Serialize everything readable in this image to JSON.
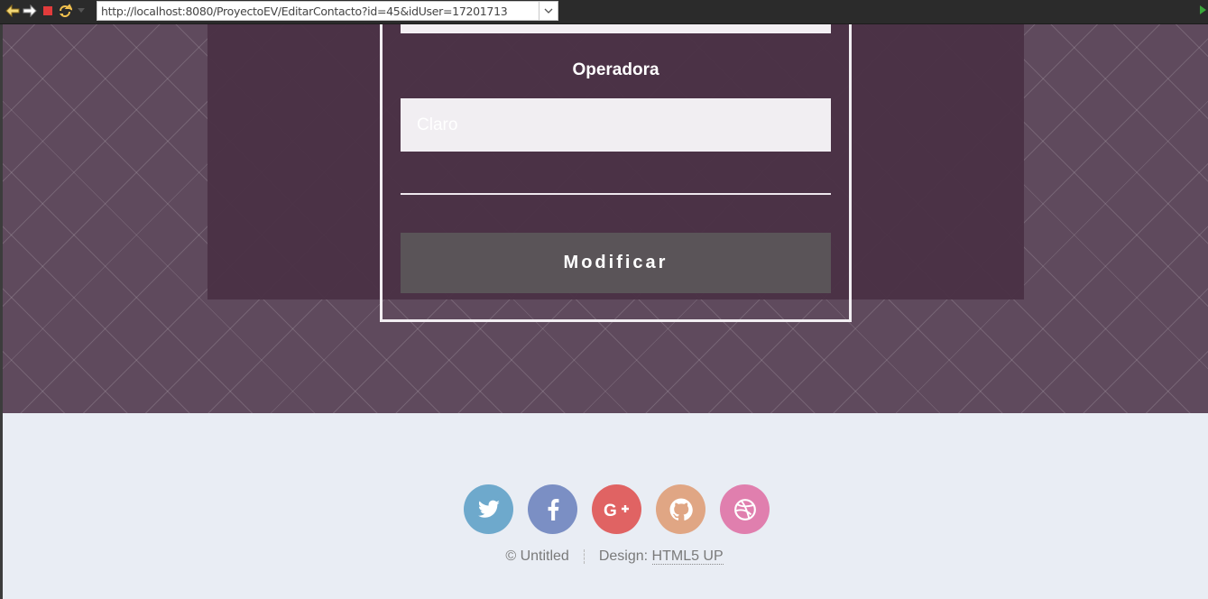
{
  "browser": {
    "url": "http://localhost:8080/ProyectoEV/EditarContacto?id=45&idUser=17201713",
    "icons": [
      "back-arrow-icon",
      "forward-arrow-icon",
      "stop-icon",
      "refresh-icon",
      "url-dropdown-icon",
      "go-icon"
    ]
  },
  "form": {
    "field_label": "Operadora",
    "field_placeholder": "Claro",
    "submit_label": "Modificar"
  },
  "footer": {
    "social": [
      {
        "name": "twitter-icon",
        "color": "#6ea9cc"
      },
      {
        "name": "facebook-icon",
        "color": "#7b8fc4"
      },
      {
        "name": "google-plus-icon",
        "color": "#e06363"
      },
      {
        "name": "github-icon",
        "color": "#e0a684"
      },
      {
        "name": "dribbble-icon",
        "color": "#e07fae"
      }
    ],
    "copyright": "© Untitled",
    "design_label": "Design:",
    "design_link": "HTML5 UP"
  },
  "colors": {
    "banner": "#5f4a5d",
    "panel": "#4a3245",
    "button": "#5a5458",
    "footer_bg": "#e9edf4"
  }
}
